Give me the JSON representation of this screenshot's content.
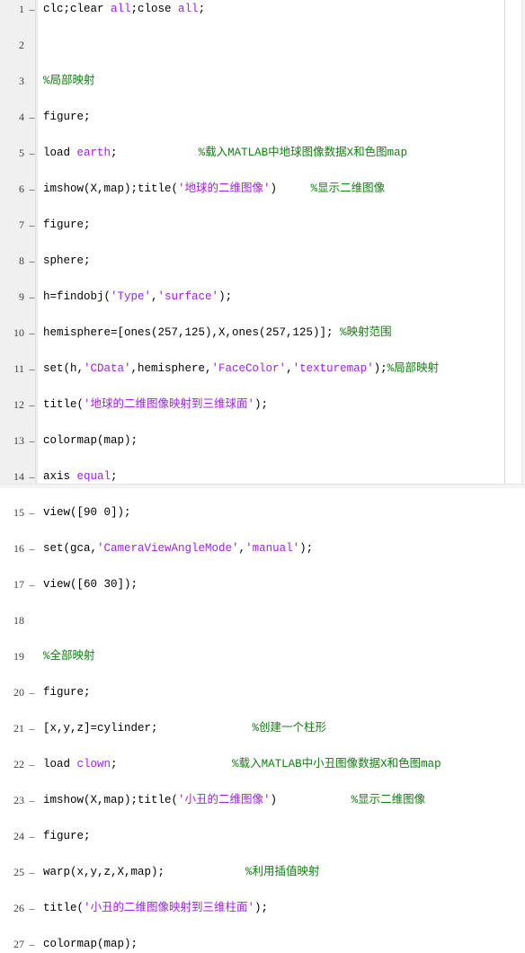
{
  "editor": {
    "app": "matlab-editor",
    "gutter_background": "#f0f0f0",
    "background": "#ffffff",
    "colors": {
      "plain": "#000000",
      "string": "#a020f0",
      "comment": "#108010",
      "keyword": "#0000ff",
      "lineno": "#404040"
    },
    "breakpoint_marker": "–",
    "lines": [
      {
        "number": "1",
        "breakpoint": true,
        "tokens": [
          {
            "t": "clc;clear ",
            "c": "plain"
          },
          {
            "t": "all",
            "c": "string"
          },
          {
            "t": ";close ",
            "c": "plain"
          },
          {
            "t": "all",
            "c": "string"
          },
          {
            "t": ";",
            "c": "plain"
          }
        ]
      },
      {
        "number": "2",
        "breakpoint": false,
        "tokens": []
      },
      {
        "number": "3",
        "breakpoint": false,
        "tokens": [
          {
            "t": "%局部映射",
            "c": "comment"
          }
        ]
      },
      {
        "number": "4",
        "breakpoint": true,
        "tokens": [
          {
            "t": "figure;",
            "c": "plain"
          }
        ]
      },
      {
        "number": "5",
        "breakpoint": true,
        "tokens": [
          {
            "t": "load ",
            "c": "plain"
          },
          {
            "t": "earth",
            "c": "string"
          },
          {
            "t": ";            ",
            "c": "plain"
          },
          {
            "t": "%载入MATLAB中地球图像数据X和色图map",
            "c": "comment"
          }
        ]
      },
      {
        "number": "6",
        "breakpoint": true,
        "tokens": [
          {
            "t": "imshow(X,map);title(",
            "c": "plain"
          },
          {
            "t": "'地球的二维图像'",
            "c": "string"
          },
          {
            "t": ")     ",
            "c": "plain"
          },
          {
            "t": "%显示二维图像",
            "c": "comment"
          }
        ]
      },
      {
        "number": "7",
        "breakpoint": true,
        "tokens": [
          {
            "t": "figure;",
            "c": "plain"
          }
        ]
      },
      {
        "number": "8",
        "breakpoint": true,
        "tokens": [
          {
            "t": "sphere;",
            "c": "plain"
          }
        ]
      },
      {
        "number": "9",
        "breakpoint": true,
        "tokens": [
          {
            "t": "h=findobj(",
            "c": "plain"
          },
          {
            "t": "'Type'",
            "c": "string"
          },
          {
            "t": ",",
            "c": "plain"
          },
          {
            "t": "'surface'",
            "c": "string"
          },
          {
            "t": ");",
            "c": "plain"
          }
        ]
      },
      {
        "number": "10",
        "breakpoint": true,
        "tokens": [
          {
            "t": "hemisphere=[ones(257,125),X,ones(257,125)]; ",
            "c": "plain"
          },
          {
            "t": "%映射范围",
            "c": "comment"
          }
        ]
      },
      {
        "number": "11",
        "breakpoint": true,
        "tokens": [
          {
            "t": "set(h,",
            "c": "plain"
          },
          {
            "t": "'CData'",
            "c": "string"
          },
          {
            "t": ",hemisphere,",
            "c": "plain"
          },
          {
            "t": "'FaceColor'",
            "c": "string"
          },
          {
            "t": ",",
            "c": "plain"
          },
          {
            "t": "'texturemap'",
            "c": "string"
          },
          {
            "t": ");",
            "c": "plain"
          },
          {
            "t": "%局部映射",
            "c": "comment"
          }
        ]
      },
      {
        "number": "12",
        "breakpoint": true,
        "tokens": [
          {
            "t": "title(",
            "c": "plain"
          },
          {
            "t": "'地球的二维图像映射到三维球面'",
            "c": "string"
          },
          {
            "t": ");",
            "c": "plain"
          }
        ]
      },
      {
        "number": "13",
        "breakpoint": true,
        "tokens": [
          {
            "t": "colormap(map);",
            "c": "plain"
          }
        ]
      },
      {
        "number": "14",
        "breakpoint": true,
        "tokens": [
          {
            "t": "axis ",
            "c": "plain"
          },
          {
            "t": "equal",
            "c": "string"
          },
          {
            "t": ";",
            "c": "plain"
          }
        ]
      },
      {
        "number": "15",
        "breakpoint": true,
        "tokens": [
          {
            "t": "view([90 0]);",
            "c": "plain"
          }
        ]
      },
      {
        "number": "16",
        "breakpoint": true,
        "tokens": [
          {
            "t": "set(gca,",
            "c": "plain"
          },
          {
            "t": "'CameraViewAngleMode'",
            "c": "string"
          },
          {
            "t": ",",
            "c": "plain"
          },
          {
            "t": "'manual'",
            "c": "string"
          },
          {
            "t": ");",
            "c": "plain"
          }
        ]
      },
      {
        "number": "17",
        "breakpoint": true,
        "tokens": [
          {
            "t": "view([60 30]);",
            "c": "plain"
          }
        ]
      },
      {
        "number": "18",
        "breakpoint": false,
        "tokens": []
      },
      {
        "number": "19",
        "breakpoint": false,
        "tokens": [
          {
            "t": "%全部映射",
            "c": "comment"
          }
        ]
      },
      {
        "number": "20",
        "breakpoint": true,
        "tokens": [
          {
            "t": "figure;",
            "c": "plain"
          }
        ]
      },
      {
        "number": "21",
        "breakpoint": true,
        "tokens": [
          {
            "t": "[x,y,z]=cylinder;              ",
            "c": "plain"
          },
          {
            "t": "%创建一个柱形",
            "c": "comment"
          }
        ]
      },
      {
        "number": "22",
        "breakpoint": true,
        "tokens": [
          {
            "t": "load ",
            "c": "plain"
          },
          {
            "t": "clown",
            "c": "string"
          },
          {
            "t": ";                 ",
            "c": "plain"
          },
          {
            "t": "%载入MATLAB中小丑图像数据X和色图map",
            "c": "comment"
          }
        ]
      },
      {
        "number": "23",
        "breakpoint": true,
        "tokens": [
          {
            "t": "imshow(X,map);title(",
            "c": "plain"
          },
          {
            "t": "'小丑的二维图像'",
            "c": "string"
          },
          {
            "t": ")           ",
            "c": "plain"
          },
          {
            "t": "%显示二维图像",
            "c": "comment"
          }
        ]
      },
      {
        "number": "24",
        "breakpoint": true,
        "tokens": [
          {
            "t": "figure;",
            "c": "plain"
          }
        ]
      },
      {
        "number": "25",
        "breakpoint": true,
        "tokens": [
          {
            "t": "warp(x,y,z,X,map);            ",
            "c": "plain"
          },
          {
            "t": "%利用插值映射",
            "c": "comment"
          }
        ]
      },
      {
        "number": "26",
        "breakpoint": true,
        "tokens": [
          {
            "t": "title(",
            "c": "plain"
          },
          {
            "t": "'小丑的二维图像映射到三维柱面'",
            "c": "string"
          },
          {
            "t": ");",
            "c": "plain"
          }
        ]
      },
      {
        "number": "27",
        "breakpoint": true,
        "tokens": [
          {
            "t": "colormap(map);",
            "c": "plain"
          }
        ]
      }
    ]
  }
}
